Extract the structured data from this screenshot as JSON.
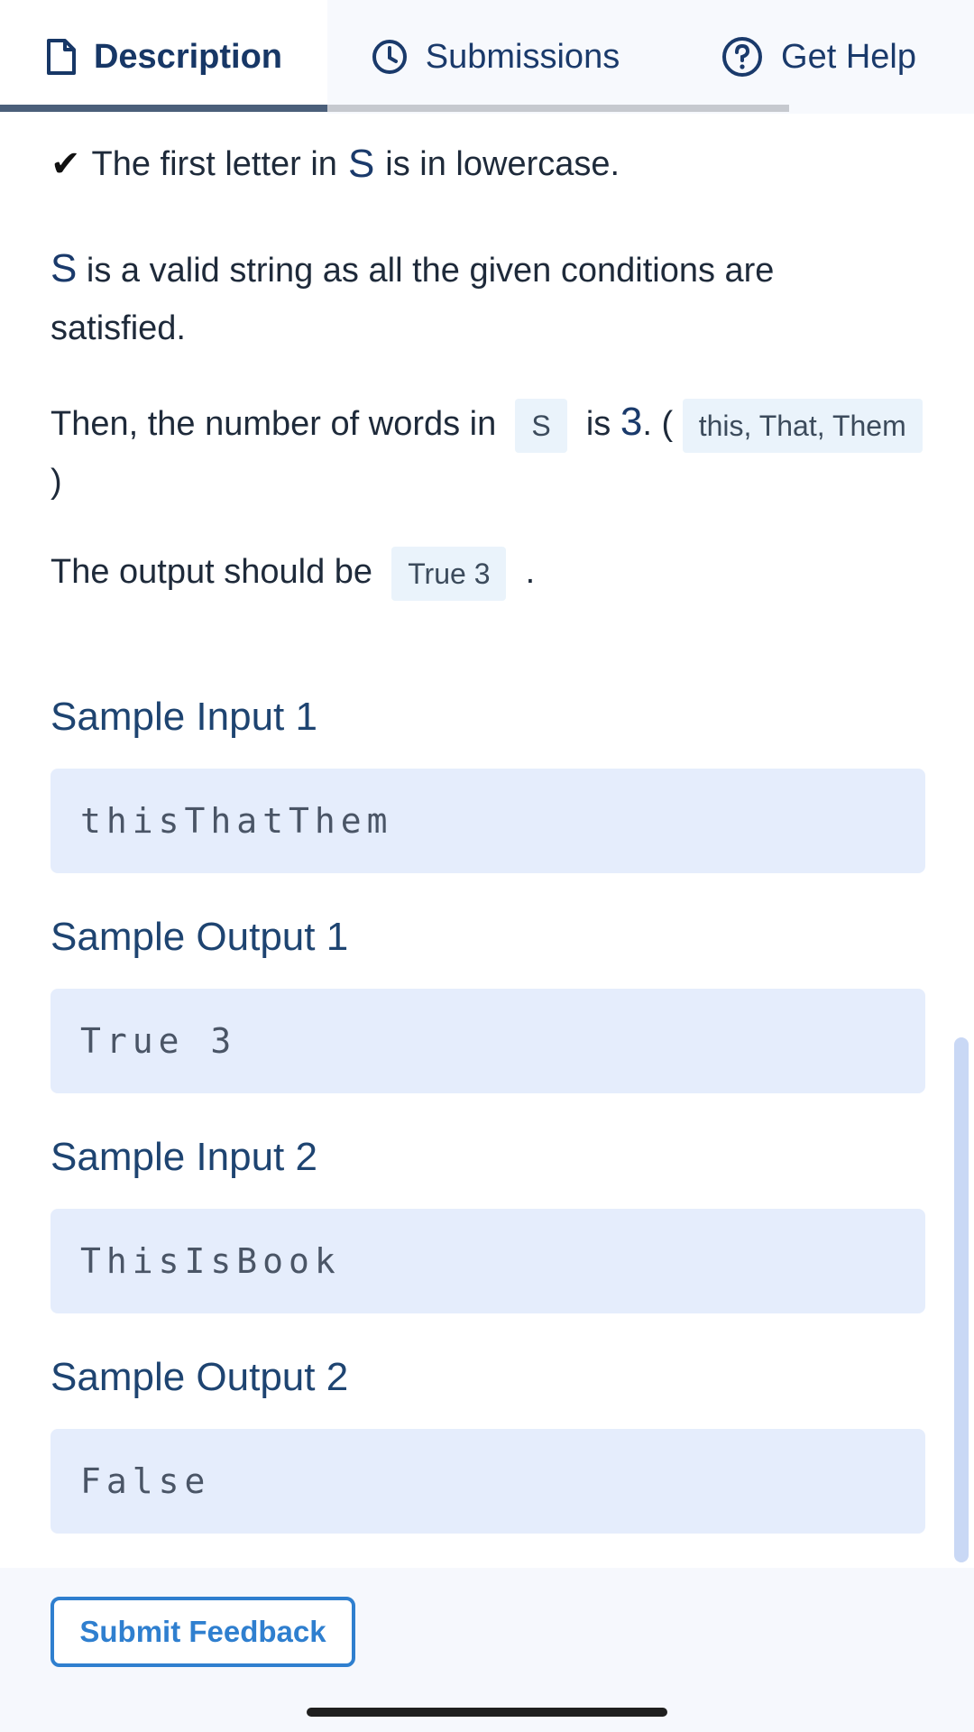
{
  "tabs": [
    {
      "label": "Description",
      "icon": "document-icon",
      "active": true
    },
    {
      "label": "Submissions",
      "icon": "clock-icon",
      "active": false
    },
    {
      "label": "Get Help",
      "icon": "question-circle-icon",
      "active": false
    }
  ],
  "content": {
    "check_line": {
      "icon": "✔",
      "pre": "The first letter in",
      "s": "S",
      "post": "is in lowercase."
    },
    "para1": {
      "s": "S",
      "text": "is a valid string as all the given conditions are satisfied."
    },
    "para2": {
      "pre": "Then, the number of words in",
      "chip_s": "S",
      "mid": "is",
      "num": "3",
      "after_num": ". (",
      "chip_words": "this, That, Them",
      "close": ")"
    },
    "para3": {
      "pre": "The output should be",
      "chip": "True 3",
      "post": "."
    }
  },
  "samples": [
    {
      "title": "Sample Input 1",
      "value": "thisThatThem"
    },
    {
      "title": "Sample Output 1",
      "value": "True 3"
    },
    {
      "title": "Sample Input 2",
      "value": "ThisIsBook"
    },
    {
      "title": "Sample Output 2",
      "value": "False"
    }
  ],
  "footer": {
    "submit_feedback": "Submit Feedback"
  },
  "colors": {
    "accent": "#2f7fcf",
    "code_bg": "#e5edfc",
    "heading": "#1e4471"
  }
}
